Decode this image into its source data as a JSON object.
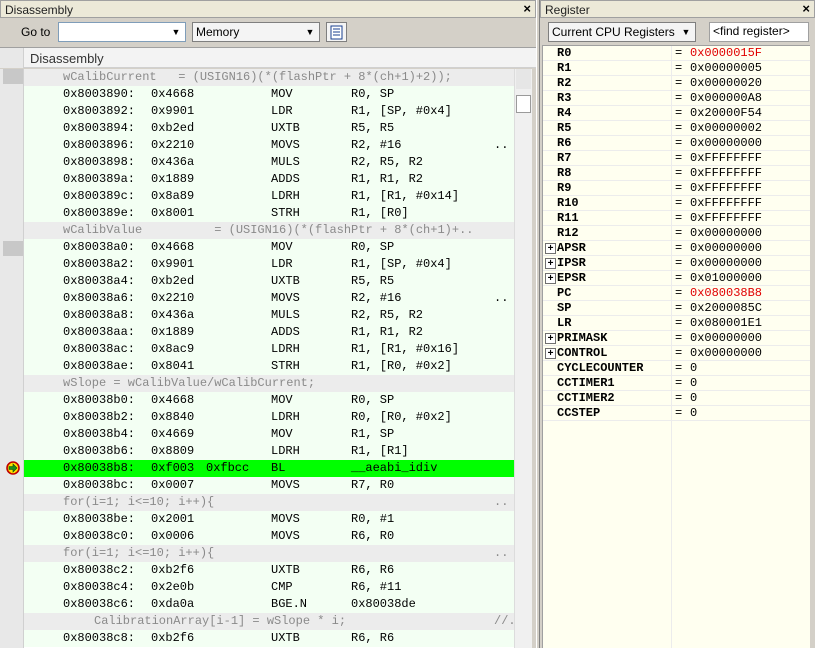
{
  "disassembly": {
    "title": "Disassembly",
    "goto_label": "Go to",
    "goto_value": "",
    "memory_value": "Memory",
    "header_title": "Disassembly",
    "rows": [
      {
        "kind": "src",
        "text": "wCalibCurrent   = (USIGN16)(*(flashPtr + 8*(ch+1)+2));",
        "indent": "src"
      },
      {
        "kind": "code",
        "addr": "0x8003890:",
        "op": "0x4668",
        "opnd": "",
        "mn": "MOV",
        "args": "R0, SP"
      },
      {
        "kind": "code",
        "addr": "0x8003892:",
        "op": "0x9901",
        "opnd": "",
        "mn": "LDR",
        "args": "R1, [SP, #0x4]"
      },
      {
        "kind": "code",
        "addr": "0x8003894:",
        "op": "0xb2ed",
        "opnd": "",
        "mn": "UXTB",
        "args": "R5, R5"
      },
      {
        "kind": "code",
        "addr": "0x8003896:",
        "op": "0x2210",
        "opnd": "",
        "mn": "MOVS",
        "args": "R2, #16",
        "dots": ".."
      },
      {
        "kind": "code",
        "addr": "0x8003898:",
        "op": "0x436a",
        "opnd": "",
        "mn": "MULS",
        "args": "R2, R5, R2"
      },
      {
        "kind": "code",
        "addr": "0x800389a:",
        "op": "0x1889",
        "opnd": "",
        "mn": "ADDS",
        "args": "R1, R1, R2"
      },
      {
        "kind": "code",
        "addr": "0x800389c:",
        "op": "0x8a89",
        "opnd": "",
        "mn": "LDRH",
        "args": "R1, [R1, #0x14]"
      },
      {
        "kind": "code",
        "addr": "0x800389e:",
        "op": "0x8001",
        "opnd": "",
        "mn": "STRH",
        "args": "R1, [R0]"
      },
      {
        "kind": "src",
        "text": "wCalibValue          = (USIGN16)(*(flashPtr + 8*(ch+1)+..",
        "indent": "src"
      },
      {
        "kind": "code",
        "addr": "0x80038a0:",
        "op": "0x4668",
        "opnd": "",
        "mn": "MOV",
        "args": "R0, SP"
      },
      {
        "kind": "code",
        "addr": "0x80038a2:",
        "op": "0x9901",
        "opnd": "",
        "mn": "LDR",
        "args": "R1, [SP, #0x4]"
      },
      {
        "kind": "code",
        "addr": "0x80038a4:",
        "op": "0xb2ed",
        "opnd": "",
        "mn": "UXTB",
        "args": "R5, R5"
      },
      {
        "kind": "code",
        "addr": "0x80038a6:",
        "op": "0x2210",
        "opnd": "",
        "mn": "MOVS",
        "args": "R2, #16",
        "dots": ".."
      },
      {
        "kind": "code",
        "addr": "0x80038a8:",
        "op": "0x436a",
        "opnd": "",
        "mn": "MULS",
        "args": "R2, R5, R2"
      },
      {
        "kind": "code",
        "addr": "0x80038aa:",
        "op": "0x1889",
        "opnd": "",
        "mn": "ADDS",
        "args": "R1, R1, R2"
      },
      {
        "kind": "code",
        "addr": "0x80038ac:",
        "op": "0x8ac9",
        "opnd": "",
        "mn": "LDRH",
        "args": "R1, [R1, #0x16]"
      },
      {
        "kind": "code",
        "addr": "0x80038ae:",
        "op": "0x8041",
        "opnd": "",
        "mn": "STRH",
        "args": "R1, [R0, #0x2]"
      },
      {
        "kind": "src",
        "text": "wSlope = wCalibValue/wCalibCurrent;",
        "indent": "src"
      },
      {
        "kind": "code",
        "addr": "0x80038b0:",
        "op": "0x4668",
        "opnd": "",
        "mn": "MOV",
        "args": "R0, SP"
      },
      {
        "kind": "code",
        "addr": "0x80038b2:",
        "op": "0x8840",
        "opnd": "",
        "mn": "LDRH",
        "args": "R0, [R0, #0x2]"
      },
      {
        "kind": "code",
        "addr": "0x80038b4:",
        "op": "0x4669",
        "opnd": "",
        "mn": "MOV",
        "args": "R1, SP"
      },
      {
        "kind": "code",
        "addr": "0x80038b6:",
        "op": "0x8809",
        "opnd": "",
        "mn": "LDRH",
        "args": "R1, [R1]"
      },
      {
        "kind": "cur",
        "addr": "0x80038b8:",
        "op": "0xf003",
        "opnd": "0xfbcc",
        "mn": "BL",
        "args": "__aeabi_idiv"
      },
      {
        "kind": "code",
        "addr": "0x80038bc:",
        "op": "0x0007",
        "opnd": "",
        "mn": "MOVS",
        "args": "R7, R0"
      },
      {
        "kind": "src",
        "text": "for(i=1; i<=10; i++){",
        "indent": "src",
        "dots": ".."
      },
      {
        "kind": "code",
        "addr": "0x80038be:",
        "op": "0x2001",
        "opnd": "",
        "mn": "MOVS",
        "args": "R0, #1"
      },
      {
        "kind": "code",
        "addr": "0x80038c0:",
        "op": "0x0006",
        "opnd": "",
        "mn": "MOVS",
        "args": "R6, R0"
      },
      {
        "kind": "src",
        "text": "for(i=1; i<=10; i++){",
        "indent": "src",
        "dots": ".."
      },
      {
        "kind": "code",
        "addr": "0x80038c2:",
        "op": "0xb2f6",
        "opnd": "",
        "mn": "UXTB",
        "args": "R6, R6"
      },
      {
        "kind": "code",
        "addr": "0x80038c4:",
        "op": "0x2e0b",
        "opnd": "",
        "mn": "CMP",
        "args": "R6, #11"
      },
      {
        "kind": "code",
        "addr": "0x80038c6:",
        "op": "0xda0a",
        "opnd": "",
        "mn": "BGE.N",
        "args": "0x80038de"
      },
      {
        "kind": "src",
        "text": "CalibrationArray[i-1] = wSlope * i;",
        "indent": "src2",
        "dots": "//.."
      },
      {
        "kind": "code",
        "addr": "0x80038c8:",
        "op": "0xb2f6",
        "opnd": "",
        "mn": "UXTB",
        "args": "R6, R6"
      }
    ]
  },
  "register": {
    "title": "Register",
    "view_value": "Current CPU Registers",
    "find_placeholder": "<find register>",
    "rows": [
      {
        "name": "R0",
        "value": "0x0000015F",
        "changed": true,
        "expandable": false
      },
      {
        "name": "R1",
        "value": "0x00000005",
        "changed": false,
        "expandable": false
      },
      {
        "name": "R2",
        "value": "0x00000020",
        "changed": false,
        "expandable": false
      },
      {
        "name": "R3",
        "value": "0x000000A8",
        "changed": false,
        "expandable": false
      },
      {
        "name": "R4",
        "value": "0x20000F54",
        "changed": false,
        "expandable": false
      },
      {
        "name": "R5",
        "value": "0x00000002",
        "changed": false,
        "expandable": false
      },
      {
        "name": "R6",
        "value": "0x00000000",
        "changed": false,
        "expandable": false
      },
      {
        "name": "R7",
        "value": "0xFFFFFFFF",
        "changed": false,
        "expandable": false
      },
      {
        "name": "R8",
        "value": "0xFFFFFFFF",
        "changed": false,
        "expandable": false
      },
      {
        "name": "R9",
        "value": "0xFFFFFFFF",
        "changed": false,
        "expandable": false
      },
      {
        "name": "R10",
        "value": "0xFFFFFFFF",
        "changed": false,
        "expandable": false
      },
      {
        "name": "R11",
        "value": "0xFFFFFFFF",
        "changed": false,
        "expandable": false
      },
      {
        "name": "R12",
        "value": "0x00000000",
        "changed": false,
        "expandable": false
      },
      {
        "name": "APSR",
        "value": "0x00000000",
        "changed": false,
        "expandable": true
      },
      {
        "name": "IPSR",
        "value": "0x00000000",
        "changed": false,
        "expandable": true
      },
      {
        "name": "EPSR",
        "value": "0x01000000",
        "changed": false,
        "expandable": true
      },
      {
        "name": "PC",
        "value": "0x080038B8",
        "changed": true,
        "expandable": false
      },
      {
        "name": "SP",
        "value": "0x2000085C",
        "changed": false,
        "expandable": false
      },
      {
        "name": "LR",
        "value": "0x080001E1",
        "changed": false,
        "expandable": false
      },
      {
        "name": "PRIMASK",
        "value": "0x00000000",
        "changed": false,
        "expandable": true
      },
      {
        "name": "CONTROL",
        "value": "0x00000000",
        "changed": false,
        "expandable": true
      },
      {
        "name": "CYCLECOUNTER",
        "value": "0",
        "changed": false,
        "expandable": false
      },
      {
        "name": "CCTIMER1",
        "value": "0",
        "changed": false,
        "expandable": false
      },
      {
        "name": "CCTIMER2",
        "value": "0",
        "changed": false,
        "expandable": false
      },
      {
        "name": "CCSTEP",
        "value": "0",
        "changed": false,
        "expandable": false
      }
    ],
    "eq_sign": "="
  },
  "icons": {
    "close": "close-icon",
    "dropdown": "chevron-down-icon",
    "options": "options-icon",
    "exec_arrow": "current-instruction-icon",
    "expand": "expand-plus-icon"
  },
  "colors": {
    "current_line": "#00ff00",
    "changed_value": "#e00000",
    "register_bg": "#fffff0"
  },
  "glyphs": {
    "close": "×",
    "dropdown": "▼",
    "expand": "+"
  }
}
